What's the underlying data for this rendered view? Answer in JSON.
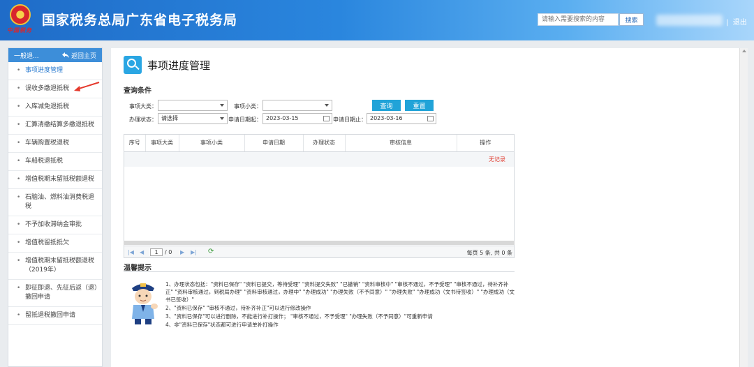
{
  "header": {
    "emblem_caption": "中国税务",
    "site_title": "国家税务总局广东省电子税务局",
    "search_placeholder": "请输入需要搜索的内容",
    "search_button": "搜索",
    "logout_label": "退出",
    "separator": "|"
  },
  "sidebar": {
    "head_label": "一般退...",
    "home_label": "返回主页",
    "items": [
      {
        "label": "事项进度管理",
        "active": true
      },
      {
        "label": "误收多缴退抵税",
        "active": false
      },
      {
        "label": "入库减免退抵税",
        "active": false
      },
      {
        "label": "汇算清缴结算多缴退抵税",
        "active": false
      },
      {
        "label": "车辆购置税退税",
        "active": false
      },
      {
        "label": "车船税退抵税",
        "active": false
      },
      {
        "label": "增值税期末留抵税额退税",
        "active": false
      },
      {
        "label": "石脑油、燃料油消费税退税",
        "active": false
      },
      {
        "label": "不予加收滞纳金审批",
        "active": false
      },
      {
        "label": "增值税留抵抵欠",
        "active": false
      },
      {
        "label": "增值税期末留抵税额退税（2019年）",
        "active": false
      },
      {
        "label": "即征即退、先征后返（退）撤回申请",
        "active": false
      },
      {
        "label": "留抵退税撤回申请",
        "active": false
      }
    ]
  },
  "main": {
    "page_title": "事项进度管理",
    "query_title": "查询条件",
    "filters": {
      "category_label": "事项大类：",
      "category_value": "",
      "subcategory_label": "事项小类：",
      "subcategory_value": "",
      "status_label": "办理状态：",
      "status_value": "请选择",
      "start_label": "申请日期起：",
      "start_value": "2023-03-15",
      "end_label": "申请日期止：",
      "end_value": "2023-03-16",
      "query_button": "查询",
      "reset_button": "重置"
    },
    "table": {
      "columns": [
        "序号",
        "事项大类",
        "事项小类",
        "申请日期",
        "办理状态",
        "审核信息",
        "操作"
      ],
      "empty_text": "无记录"
    },
    "pager": {
      "page_value": "1",
      "total_pages": "/ 0",
      "summary": "每页 5 条, 共 0 条"
    },
    "tips": {
      "title": "温馨提示",
      "lines": [
        "1、办理状态包括：\"资料已保存\" \"资料已提交，等待受理\" \"资料提交失败\" \"已撤销\" \"资料审核中\" \"审核不通过，不予受理\" \"审核不通过，待补齐补正\" \"资料审核通过，到税局办理\" \"资料审核通过，办理中\" \"办理成功\" \"办理失败（不予同意）\" \"办理失败\" \"办理成功（文书待签收）\" \"办理成功（文书已签收）\"",
        "2、\"资料已保存\" \"审核不通过，待补齐补正\"可以进行修改操作",
        "3、\"资料已保存\"可以进行删除，不能进行补打操作； \"审核不通过，不予受理\" \"办理失败（不予同意）\"可重新申请",
        "4、非\"资料已保存\"状态都可进行申请单补打操作"
      ]
    }
  },
  "colors": {
    "header_blue": "#1f6cc8",
    "accent": "#21a3d8",
    "no_record": "#e03b2e",
    "annotation_arrow": "#e53a2d"
  }
}
